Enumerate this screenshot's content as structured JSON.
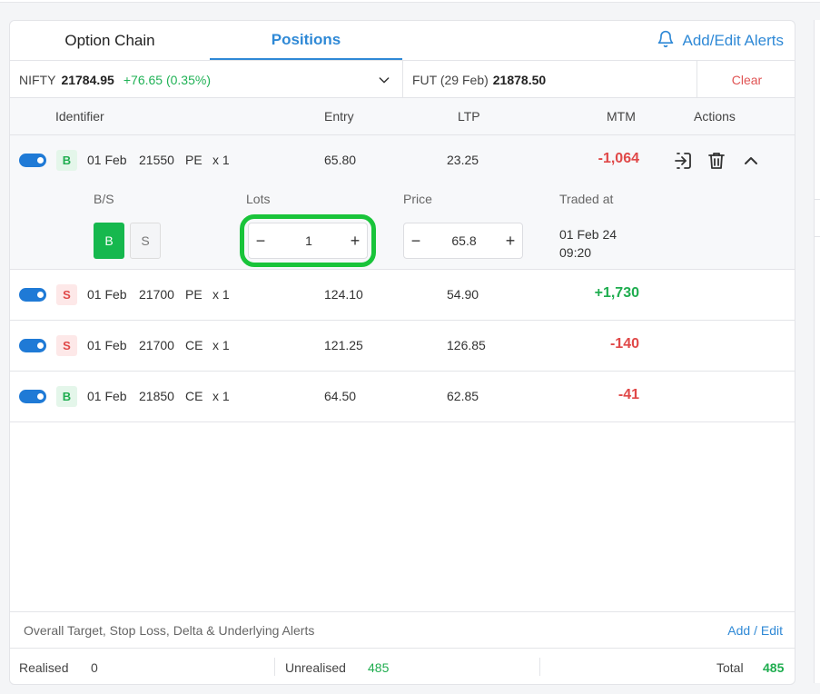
{
  "tabs": [
    {
      "label": "Option Chain",
      "active": false
    },
    {
      "label": "Positions",
      "active": true
    }
  ],
  "alerts_label": "Add/Edit Alerts",
  "instrument": {
    "name": "NIFTY",
    "price": "21784.95",
    "change": "+76.65 (0.35%)",
    "fut_label": "FUT (29 Feb)",
    "fut_price": "21878.50",
    "clear_label": "Clear"
  },
  "columns": {
    "identifier": "Identifier",
    "entry": "Entry",
    "ltp": "LTP",
    "mtm": "MTM",
    "actions": "Actions"
  },
  "positions": [
    {
      "side": "B",
      "date": "01 Feb",
      "strike": "21550",
      "type": "PE",
      "qty": "x 1",
      "entry": "65.80",
      "ltp": "23.25",
      "mtm": "-1,064"
    },
    {
      "side": "S",
      "date": "01 Feb",
      "strike": "21700",
      "type": "PE",
      "qty": "x 1",
      "entry": "124.10",
      "ltp": "54.90",
      "mtm": "+1,730"
    },
    {
      "side": "S",
      "date": "01 Feb",
      "strike": "21700",
      "type": "CE",
      "qty": "x 1",
      "entry": "121.25",
      "ltp": "126.85",
      "mtm": "-140"
    },
    {
      "side": "B",
      "date": "01 Feb",
      "strike": "21850",
      "type": "CE",
      "qty": "x 1",
      "entry": "64.50",
      "ltp": "62.85",
      "mtm": "-41"
    }
  ],
  "expanded": {
    "bs_label": "B/S",
    "lots_label": "Lots",
    "price_label": "Price",
    "traded_label": "Traded at",
    "buy_label": "B",
    "sell_label": "S",
    "lots_value": "1",
    "price_value": "65.8",
    "minus": "−",
    "plus": "+",
    "traded_date": "01 Feb 24",
    "traded_time": "09:20"
  },
  "footer": {
    "alerts_text": "Overall Target, Stop Loss, Delta & Underlying Alerts",
    "add_edit": "Add / Edit",
    "realised_label": "Realised",
    "realised_value": "0",
    "unrealised_label": "Unrealised",
    "unrealised_value": "485",
    "total_label": "Total",
    "total_value": "485"
  },
  "colors": {
    "accent": "#2f89d6",
    "positive": "#1fad4f",
    "negative": "#e04848",
    "highlight": "#19c43a"
  }
}
